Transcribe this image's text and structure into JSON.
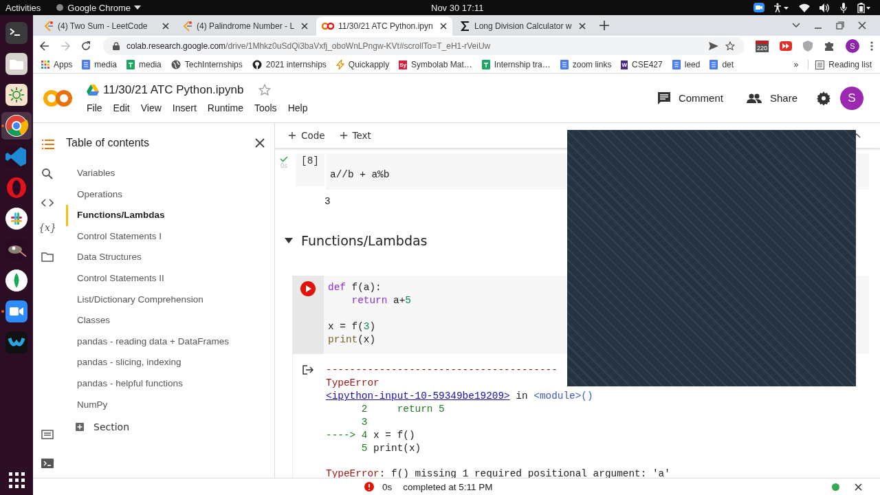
{
  "topbar": {
    "activities": "Activities",
    "app": "Google Chrome",
    "clock": "Nov 30  17:11"
  },
  "dock": {
    "apps": [
      {
        "kind": "terminal",
        "selected": false,
        "running": false
      },
      {
        "kind": "folder",
        "selected": false,
        "running": false
      },
      {
        "kind": "sun",
        "selected": false,
        "running": false
      },
      {
        "kind": "browser",
        "selected": true,
        "running": true
      },
      {
        "kind": "editor",
        "selected": false,
        "running": false
      },
      {
        "kind": "ring",
        "selected": false,
        "running": false
      },
      {
        "kind": "chat",
        "selected": false,
        "running": false
      },
      {
        "kind": "creature",
        "selected": false,
        "running": false
      },
      {
        "kind": "leaf",
        "selected": false,
        "running": false
      },
      {
        "kind": "camera",
        "selected": false,
        "running": true
      },
      {
        "kind": "loop",
        "selected": false,
        "running": false
      }
    ]
  },
  "tabs": [
    {
      "title": "(4) Two Sum - LeetCode",
      "kind": "leet",
      "selected": false
    },
    {
      "title": "(4) Palindrome Number - L",
      "kind": "leet",
      "selected": false
    },
    {
      "title": "11/30/21 ATC Python.ipyn",
      "kind": "colab",
      "selected": true
    },
    {
      "title": "Long Division Calculator w",
      "kind": "sigma",
      "selected": false
    }
  ],
  "address": {
    "host": "colab.research.google.com",
    "path": "/drive/1Mhkz0uSdQi3baVxfj_oboWnLPngw-KVt#scrollTo=T_eH1-rVeiUw",
    "extension_badge": "220",
    "profile": "S"
  },
  "bookmarks": [
    {
      "label": "Apps",
      "kind": "apps"
    },
    {
      "label": "media",
      "kind": "doc"
    },
    {
      "label": "media",
      "kind": "sheet"
    },
    {
      "label": "TechInternships",
      "kind": "globe"
    },
    {
      "label": "2021 internships",
      "kind": "github"
    },
    {
      "label": "Quickapply",
      "kind": "bolt"
    },
    {
      "label": "Symbolab Mat…",
      "kind": "letter",
      "letter": "Sy",
      "color": "#d6203c"
    },
    {
      "label": "Internship tra…",
      "kind": "sheet"
    },
    {
      "label": "zoom links",
      "kind": "doc"
    },
    {
      "label": "CSE427",
      "kind": "letter",
      "letter": "W",
      "color": "#4b2a85"
    },
    {
      "label": "leed",
      "kind": "doc"
    },
    {
      "label": "det",
      "kind": "doc"
    }
  ],
  "bookmarks_more": "»",
  "reading_list": "Reading list",
  "notebook": {
    "title": "11/30/21 ATC Python.ipynb",
    "starred": false,
    "menu": [
      "File",
      "Edit",
      "View",
      "Insert",
      "Runtime",
      "Tools",
      "Help"
    ],
    "comment": "Comment",
    "share": "Share",
    "avatar": "S"
  },
  "side_rail": {
    "variables_glyph": "{x}"
  },
  "toc": {
    "title": "Table of contents",
    "items": [
      {
        "label": "Variables",
        "selected": false
      },
      {
        "label": "Operations",
        "selected": false
      },
      {
        "label": "Functions/Lambdas",
        "selected": true
      },
      {
        "label": "Control Statements I",
        "selected": false
      },
      {
        "label": "Data Structures",
        "selected": false
      },
      {
        "label": "Control Statements II",
        "selected": false
      },
      {
        "label": "List/Dictionary Comprehension",
        "selected": false
      },
      {
        "label": "Classes",
        "selected": false
      },
      {
        "label": "pandas - reading data + DataFrames",
        "selected": false
      },
      {
        "label": "pandas - slicing, indexing",
        "selected": false
      },
      {
        "label": "pandas - helpful functions",
        "selected": false
      },
      {
        "label": "NumPy",
        "selected": false
      }
    ],
    "add_section": "Section"
  },
  "toolbar": {
    "add_code": "Code",
    "add_text": "Text"
  },
  "cells": [
    {
      "kind": "code",
      "execution": "[8]",
      "time": "0s",
      "error": false,
      "blocks": [
        [
          [
            {
              "t": "a//b + a%b",
              "kind": "plain"
            }
          ]
        ]
      ],
      "output": [
        [
          {
            "t": "3",
            "kind": "plain"
          }
        ]
      ]
    },
    {
      "kind": "heading",
      "text": "Functions/Lambdas",
      "expanded": true
    },
    {
      "kind": "code",
      "error": true,
      "blocks": [
        [
          [
            {
              "t": "def",
              "kind": "keyword"
            },
            {
              "t": " f(a):",
              "kind": "plain"
            }
          ],
          [
            {
              "t": "    return",
              "kind": "keyword"
            },
            {
              "t": " a+",
              "kind": "plain"
            },
            {
              "t": "5",
              "kind": "number"
            }
          ]
        ],
        [
          [
            {
              "t": "x = f(",
              "kind": "plain"
            },
            {
              "t": "3",
              "kind": "number"
            },
            {
              "t": ")",
              "kind": "plain"
            }
          ],
          [
            {
              "t": "print",
              "kind": "builtin"
            },
            {
              "t": "(x)",
              "kind": "plain"
            }
          ]
        ]
      ],
      "output": [
        [
          {
            "t": "---------------------------------------",
            "kind": "error"
          }
        ],
        [
          {
            "t": "TypeError",
            "kind": "error"
          }
        ],
        [
          {
            "t": "<ipython-input-10-59349be19209>",
            "kind": "link"
          },
          {
            "t": " in ",
            "kind": "plain"
          },
          {
            "t": "<module>()",
            "kind": "module"
          }
        ],
        [
          {
            "t": "      2     return 5",
            "kind": "trace"
          }
        ],
        [
          {
            "t": "      3",
            "kind": "trace"
          }
        ],
        [
          {
            "t": "----> 4 ",
            "kind": "trace"
          },
          {
            "t": "x = f()",
            "kind": "plain"
          }
        ],
        [
          {
            "t": "      5 ",
            "kind": "trace"
          },
          {
            "t": "print(x)",
            "kind": "plain"
          }
        ]
      ],
      "error_message": [
        {
          "t": "TypeError",
          "kind": "error"
        },
        {
          "t": ": f() missing 1 required positional argument: 'a'",
          "kind": "plain"
        }
      ]
    }
  ],
  "status_bar": {
    "error": true,
    "time": "0s",
    "message": "completed at 5:11 PM",
    "connected": true
  }
}
